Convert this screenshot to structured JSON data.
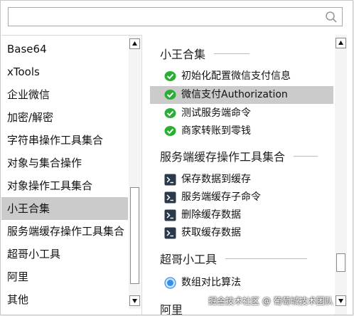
{
  "search": {
    "value": "",
    "placeholder": ""
  },
  "left_list": {
    "items": [
      {
        "label": "Base64"
      },
      {
        "label": "xTools"
      },
      {
        "label": "企业微信"
      },
      {
        "label": "加密/解密"
      },
      {
        "label": "字符串操作工具集合"
      },
      {
        "label": "对象与集合操作"
      },
      {
        "label": "对象操作工具集合"
      },
      {
        "label": "小王合集"
      },
      {
        "label": "服务端缓存操作工具集合"
      },
      {
        "label": "超哥小工具"
      },
      {
        "label": "阿里"
      },
      {
        "label": "其他"
      }
    ],
    "selected_index": 7
  },
  "right_list": {
    "groups": [
      {
        "title": "小王合集",
        "items": [
          {
            "label": "初始化配置微信支付信息",
            "icon": "wechat-pay-icon"
          },
          {
            "label": "微信支付Authorization",
            "icon": "wechat-pay-icon"
          },
          {
            "label": "测试服务端命令",
            "icon": "wechat-pay-icon"
          },
          {
            "label": "商家转账到零钱",
            "icon": "wechat-pay-icon"
          }
        ]
      },
      {
        "title": "服务端缓存操作工具集合",
        "items": [
          {
            "label": "保存数据到缓存",
            "icon": "terminal-icon"
          },
          {
            "label": "服务端缓存子命令",
            "icon": "terminal-icon"
          },
          {
            "label": "删除缓存数据",
            "icon": "terminal-icon"
          },
          {
            "label": "获取缓存数据",
            "icon": "terminal-icon"
          }
        ]
      },
      {
        "title": "超哥小工具",
        "items": [
          {
            "label": "数组对比算法",
            "icon": "compare-circle-icon"
          }
        ]
      },
      {
        "title": "阿里",
        "items": []
      }
    ],
    "selected_item": "微信支付Authorization"
  },
  "watermark": "掘金技术社区 @ 葡萄城技术团队",
  "colors": {
    "selection": "#cbcbcb",
    "wechat_green": "#2aae34",
    "terminal_bg": "#2b3a4a",
    "compare_blue": "#3a8ee6"
  }
}
